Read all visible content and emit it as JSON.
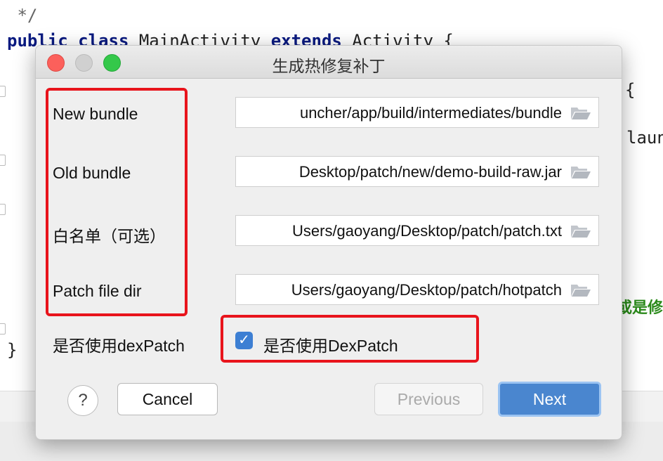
{
  "editor": {
    "comment_end": " */",
    "code_line": {
      "kw1": "public",
      "kw2": "class",
      "name": " MainActivity ",
      "kw3": "extends",
      "rest": " Activity {"
    },
    "brace1": "{",
    "partial1": "laun",
    "partial_green": "或是修",
    "brace_end": "}"
  },
  "dialog": {
    "title": "生成热修复补丁",
    "fields": [
      {
        "label": "New bundle",
        "value": "uncher/app/build/intermediates/bundle"
      },
      {
        "label": "Old bundle",
        "value": "Desktop/patch/new/demo-build-raw.jar"
      },
      {
        "label": "白名单（可选）",
        "value": "Users/gaoyang/Desktop/patch/patch.txt"
      },
      {
        "label": "Patch file dir",
        "value": "Users/gaoyang/Desktop/patch/hotpatch"
      }
    ],
    "dexpatch": {
      "label": "是否使用dexPatch",
      "checkbox_label": "是否使用DexPatch",
      "checked": true
    },
    "buttons": {
      "help": "?",
      "cancel": "Cancel",
      "previous": "Previous",
      "next": "Next"
    },
    "colors": {
      "highlight": "#e8141c",
      "accent": "#4a86cf"
    }
  }
}
